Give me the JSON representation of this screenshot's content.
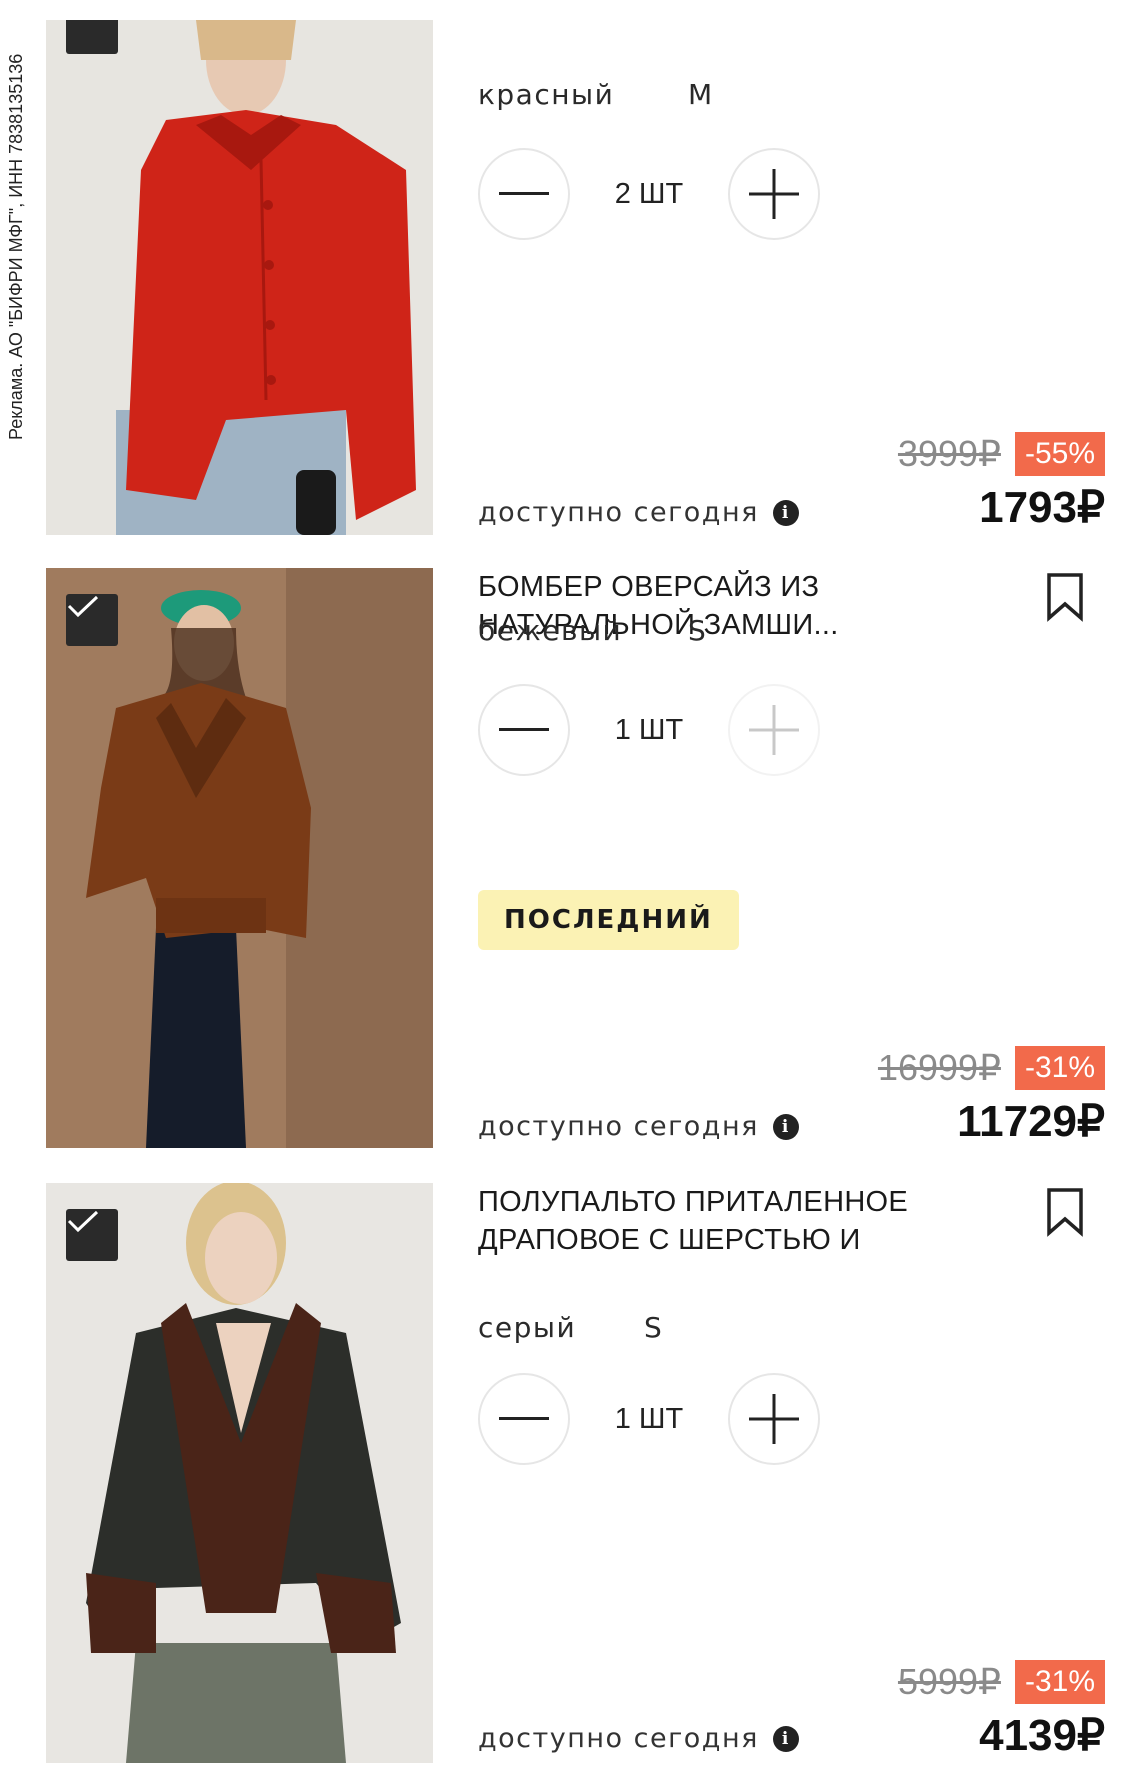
{
  "ad_label": "Реклама. АО \"БИФРИ МФГ\", ИНН 7838135136",
  "colors": {
    "discount_bg": "#f26a4b",
    "last_tag_bg": "#fbf2b4",
    "checkbox_bg": "#2a2a2a"
  },
  "items": [
    {
      "title": "",
      "color": "красный",
      "size": "M",
      "quantity": "2 ШТ",
      "plus_enabled": true,
      "tag": "",
      "availability": "доступно сегодня",
      "old_price": "3999₽",
      "discount": "-55%",
      "price": "1793₽"
    },
    {
      "title": "БОМБЕР ОВЕРСАЙЗ ИЗ НАТУРАЛЬНОЙ ЗАМШИ...",
      "color": "бежевый",
      "size": "S",
      "quantity": "1 ШТ",
      "plus_enabled": false,
      "tag": "ПОСЛЕДНИЙ",
      "availability": "доступно сегодня",
      "old_price": "16999₽",
      "discount": "-31%",
      "price": "11729₽"
    },
    {
      "title": "ПОЛУПАЛЬТО ПРИТАЛЕННОЕ ДРАПОВОЕ С ШЕРСТЬЮ И МЕХОМ",
      "color": "серый",
      "size": "S",
      "quantity": "1 ШТ",
      "plus_enabled": true,
      "tag": "",
      "availability": "доступно сегодня",
      "old_price": "5999₽",
      "discount": "-31%",
      "price": "4139₽"
    }
  ],
  "icons": [
    "checkbox-checked-icon",
    "bookmark-icon",
    "minus-icon",
    "plus-icon",
    "info-icon"
  ]
}
